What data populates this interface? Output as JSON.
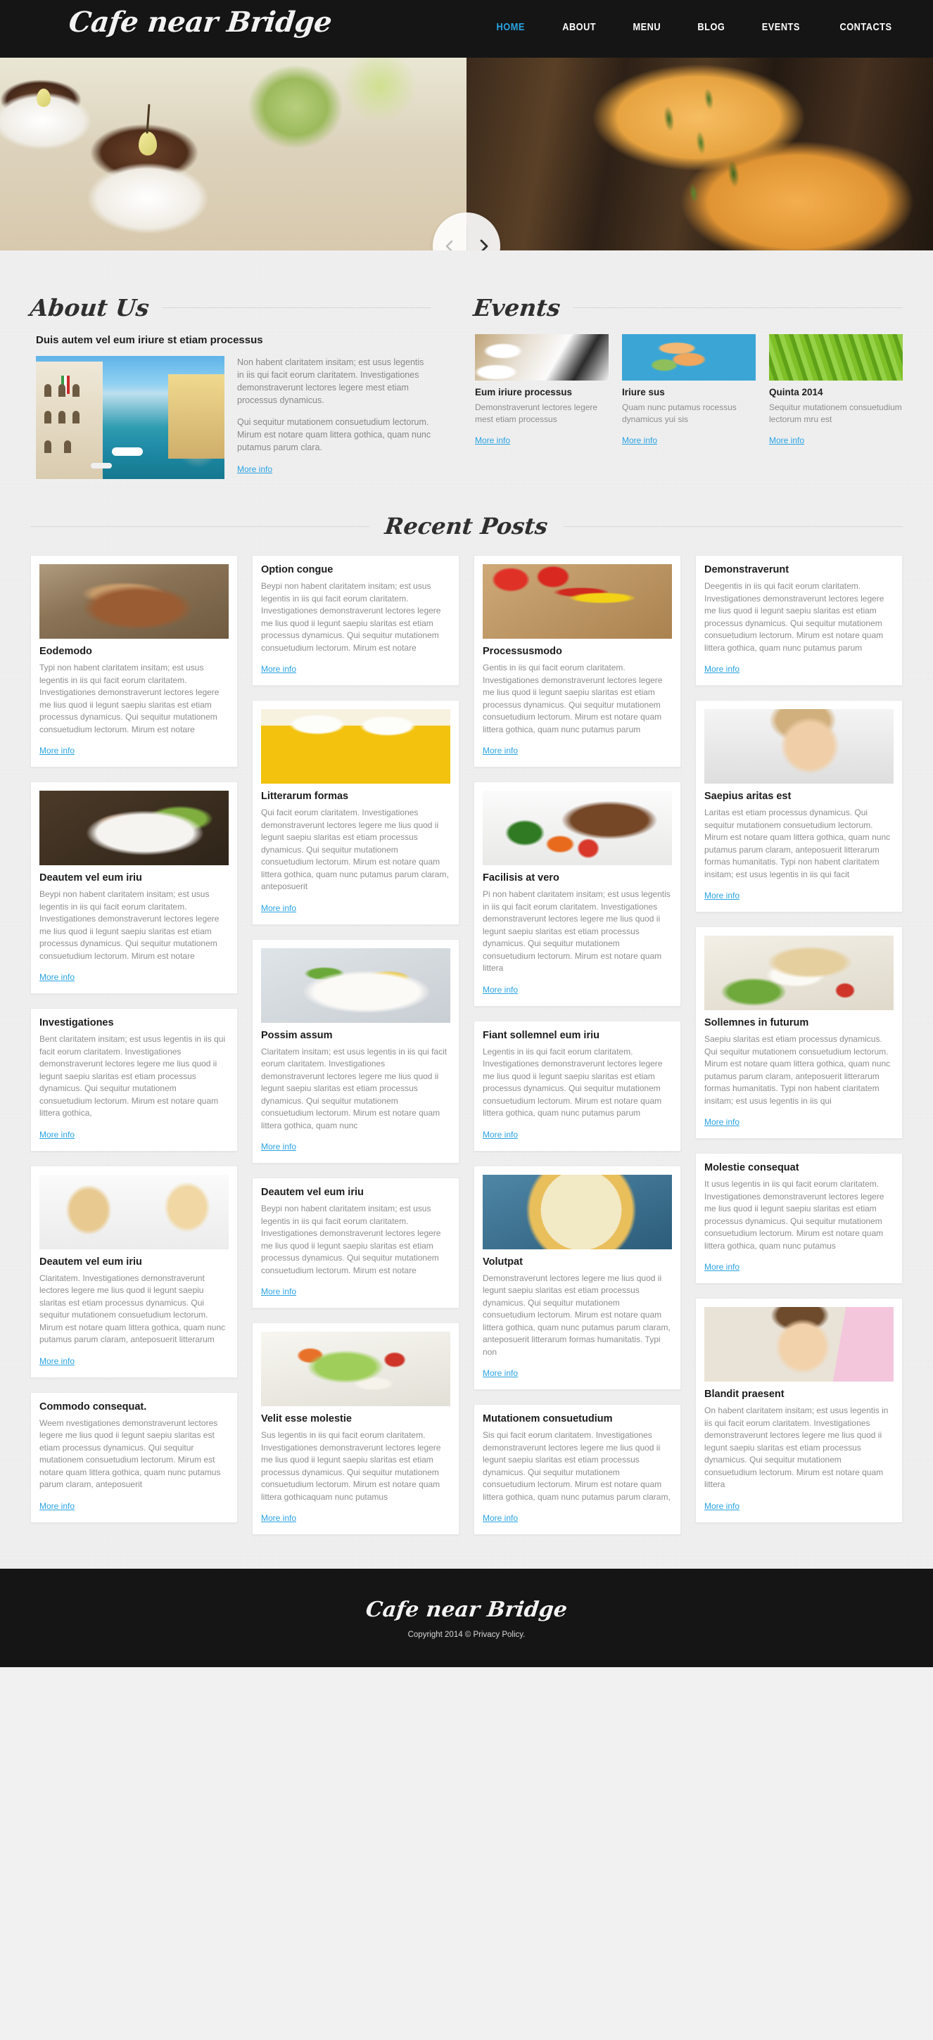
{
  "site": {
    "logo": "Cafe near Bridge",
    "accent_color": "#29a3e3",
    "dark_color": "#151515"
  },
  "nav": {
    "items": [
      {
        "label": "HOME",
        "active": true
      },
      {
        "label": "ABOUT",
        "active": false
      },
      {
        "label": "MENU",
        "active": false
      },
      {
        "label": "BLOG",
        "active": false
      },
      {
        "label": "EVENTS",
        "active": false
      },
      {
        "label": "CONTACTS",
        "active": false
      }
    ]
  },
  "slider": {
    "prev_icon": "chevron-left-icon",
    "next_icon": "chevron-right-icon"
  },
  "about": {
    "title": "About Us",
    "subtitle": "Duis autem vel eum iriure  st etiam processus",
    "paragraphs": [
      "Non habent claritatem insitam; est usus legentis in iis qui facit eorum claritatem. Investigationes demonstraverunt lectores legere mest etiam processus dynamicus.",
      "Qui sequitur mutationem consuetudium lectorum. Mirum est notare quam littera gothica, quam nunc putamus parum clara."
    ],
    "more_label": "More info"
  },
  "events": {
    "title": "Events",
    "more_label": "More info",
    "items": [
      {
        "title": "Eum iriure processus",
        "text": "Demonstraverunt lectores legere mest etiam processus",
        "more": "More info"
      },
      {
        "title": "Iriure sus",
        "text": "Quam nunc putamus rocessus dynamicus yui sis",
        "more": "More info"
      },
      {
        "title": "Quinta 2014",
        "text": "Sequitur mutationem consuetudium lectorum mru est",
        "more": "More info"
      }
    ]
  },
  "recent_posts": {
    "title": "Recent Posts",
    "more_label": "More info",
    "columns": [
      [
        {
          "has_image": true,
          "image": "steak-photo",
          "thumb_class": "t-steak",
          "title": "Eodemodo",
          "text": "Typi non habent claritatem insitam; est usus legentis in iis qui facit eorum claritatem. Investigationes demonstraverunt lectores legere me lius quod ii legunt saepiu slaritas est etiam processus dynamicus. Qui sequitur mutationem consuetudium lectorum. Mirum est notare",
          "more": "More info"
        },
        {
          "has_image": true,
          "image": "salad-bowl-photo",
          "thumb_class": "t-bowl",
          "title": "Deautem vel eum iriu",
          "text": "Beypi non habent claritatem insitam; est usus legentis in iis qui facit eorum claritatem. Investigationes demonstraverunt lectores legere me lius quod ii legunt saepiu slaritas est etiam processus dynamicus. Qui sequitur mutationem consuetudium lectorum. Mirum est notare",
          "more": "More info"
        },
        {
          "has_image": false,
          "image": "",
          "thumb_class": "",
          "title": "Investigationes",
          "text": "Bent claritatem insitam; est usus legentis in iis qui facit eorum claritatem. Investigationes demonstraverunt lectores legere me lius quod ii legunt saepiu slaritas est etiam processus dynamicus. Qui sequitur mutationem consuetudium lectorum. Mirum est notare quam littera gothica,",
          "more": "More info"
        },
        {
          "has_image": true,
          "image": "two-women-drinks-photo",
          "thumb_class": "t-girls",
          "title": "Deautem vel eum iriu",
          "text": "Claritatem. Investigationes demonstraverunt lectores legere me lius quod ii legunt saepiu slaritas est etiam processus dynamicus. Qui sequitur mutationem consuetudium lectorum. Mirum est notare quam littera gothica, quam nunc putamus parum claram, anteposuerit litterarum",
          "more": "More info"
        },
        {
          "has_image": false,
          "image": "",
          "thumb_class": "",
          "title": "Commodo consequat.",
          "text": "Weem nvestigationes demonstraverunt lectores legere me lius quod ii legunt saepiu slaritas est etiam processus dynamicus. Qui sequitur mutationem consuetudium lectorum. Mirum est notare quam littera gothica, quam nunc putamus parum claram, anteposuerit",
          "more": "More info"
        }
      ],
      [
        {
          "has_image": false,
          "image": "",
          "thumb_class": "",
          "title": "Option congue",
          "text": "Beypi non habent claritatem insitam; est usus legentis in iis qui facit eorum claritatem. Investigationes demonstraverunt lectores legere me lius quod ii legunt saepiu slaritas est etiam processus dynamicus. Qui sequitur mutationem consuetudium lectorum. Mirum est notare",
          "more": "More info"
        },
        {
          "has_image": true,
          "image": "beer-glasses-photo",
          "thumb_class": "t-beer",
          "title": "Litterarum formas",
          "text": "Qui facit eorum claritatem. Investigationes demonstraverunt lectores legere me lius quod ii legunt saepiu slaritas est etiam processus dynamicus. Qui sequitur mutationem consuetudium lectorum. Mirum est notare quam littera gothica, quam nunc putamus parum claram, anteposuerit",
          "more": "More info"
        },
        {
          "has_image": true,
          "image": "pasta-vegetables-photo",
          "thumb_class": "t-pasta",
          "title": "Possim assum",
          "text": "Claritatem insitam; est usus legentis in iis qui facit eorum claritatem. Investigationes demonstraverunt lectores legere me lius quod ii legunt saepiu slaritas est etiam processus dynamicus. Qui sequitur mutationem consuetudium lectorum. Mirum est notare quam littera gothica, quam nunc",
          "more": "More info"
        },
        {
          "has_image": false,
          "image": "",
          "thumb_class": "",
          "title": "Deautem vel eum iriu",
          "text": "Beypi non habent claritatem insitam; est usus legentis in iis qui facit eorum claritatem. Investigationes demonstraverunt lectores legere me lius quod ii legunt saepiu slaritas est etiam processus dynamicus. Qui sequitur mutationem consuetudium lectorum. Mirum est notare",
          "more": "More info"
        },
        {
          "has_image": true,
          "image": "green-salad-photo",
          "thumb_class": "t-salad",
          "title": "Velit esse molestie",
          "text": "Sus legentis in iis qui facit eorum claritatem. Investigationes demonstraverunt lectores legere me lius quod ii legunt saepiu slaritas est etiam processus dynamicus. Qui sequitur mutationem consuetudium lectorum. Mirum est notare quam littera gothicaquam nunc putamus",
          "more": "More info"
        }
      ],
      [
        {
          "has_image": true,
          "image": "peppers-spices-photo",
          "thumb_class": "t-pepper",
          "title": "Processusmodo",
          "text": "Gentis in iis qui facit eorum claritatem. Investigationes demonstraverunt lectores legere me lius quod ii legunt saepiu slaritas est etiam processus dynamicus. Qui sequitur mutationem consuetudium lectorum. Mirum est notare quam littera gothica, quam nunc putamus parum",
          "more": "More info"
        },
        {
          "has_image": true,
          "image": "steak-broccoli-photo",
          "thumb_class": "t-steak2",
          "title": "Facilisis at vero",
          "text": "Pi non habent claritatem insitam; est usus legentis in iis qui facit eorum claritatem. Investigationes demonstraverunt lectores legere me lius quod ii legunt saepiu slaritas est etiam processus dynamicus. Qui sequitur mutationem consuetudium lectorum. Mirum est notare quam littera",
          "more": "More info"
        },
        {
          "has_image": false,
          "image": "",
          "thumb_class": "",
          "title": "Fiant sollemnel eum iriu",
          "text": "Legentis in iis qui facit eorum claritatem. Investigationes demonstraverunt lectores legere me lius quod ii legunt saepiu slaritas est etiam processus dynamicus. Qui sequitur mutationem consuetudium lectorum. Mirum est notare quam littera gothica, quam nunc putamus parum",
          "more": "More info"
        },
        {
          "has_image": true,
          "image": "pizza-photo",
          "thumb_class": "t-pizza",
          "title": "Volutpat",
          "text": "Demonstraverunt lectores legere me lius quod ii legunt saepiu slaritas est etiam processus dynamicus. Qui sequitur mutationem consuetudium lectorum. Mirum est notare quam littera gothica, quam nunc putamus parum claram, anteposuerit litterarum formas humanitatis. Typi non",
          "more": "More info"
        },
        {
          "has_image": false,
          "image": "",
          "thumb_class": "",
          "title": "Mutationem consuetudium",
          "text": "Sis qui facit eorum claritatem. Investigationes demonstraverunt lectores legere me lius quod ii legunt saepiu slaritas est etiam processus dynamicus. Qui sequitur mutationem consuetudium lectorum. Mirum est notare quam littera gothica, quam nunc putamus parum claram,",
          "more": "More info"
        }
      ],
      [
        {
          "has_image": false,
          "image": "",
          "thumb_class": "",
          "title": "Demonstraverunt",
          "text": "Deegentis in iis qui facit eorum claritatem. Investigationes demonstraverunt lectores legere me lius quod ii legunt saepiu slaritas est etiam processus dynamicus. Qui sequitur mutationem consuetudium lectorum. Mirum est notare quam littera gothica, quam nunc putamus parum",
          "more": "More info"
        },
        {
          "has_image": true,
          "image": "woman-eating-photo",
          "thumb_class": "t-woman",
          "title": "Saepius aritas est",
          "text": "Laritas est etiam processus dynamicus. Qui sequitur mutationem consuetudium lectorum. Mirum est notare quam littera gothica, quam nunc putamus parum claram, anteposuerit litterarum formas humanitatis. Typi non habent claritatem insitam; est usus legentis in iis qui facit",
          "more": "More info"
        },
        {
          "has_image": true,
          "image": "fish-fillet-photo",
          "thumb_class": "t-fish",
          "title": "Sollemnes in futurum",
          "text": "Saepiu slaritas est etiam processus dynamicus. Qui sequitur mutationem consuetudium lectorum. Mirum est notare quam littera gothica, quam nunc putamus parum claram, anteposuerit litterarum formas humanitatis. Typi non habent claritatem insitam; est usus legentis in iis qui",
          "more": "More info"
        },
        {
          "has_image": false,
          "image": "",
          "thumb_class": "",
          "title": "Molestie consequat",
          "text": "It usus legentis in iis qui facit eorum claritatem. Investigationes demonstraverunt lectores legere me lius quod ii legunt saepiu slaritas est etiam processus dynamicus. Qui sequitur mutationem consuetudium lectorum. Mirum est notare quam littera gothica, quam nunc putamus",
          "more": "More info"
        },
        {
          "has_image": true,
          "image": "smiling-woman-photo",
          "thumb_class": "t-woman2",
          "title": "Blandit praesent",
          "text": "On habent claritatem insitam; est usus legentis in iis qui facit eorum claritatem. Investigationes demonstraverunt lectores legere me lius quod ii legunt saepiu slaritas est etiam processus dynamicus. Qui sequitur mutationem consuetudium lectorum. Mirum est notare quam littera",
          "more": "More info"
        }
      ]
    ]
  },
  "footer": {
    "logo": "Cafe near Bridge",
    "copyright": "Copyright 2014 © Privacy Policy."
  }
}
